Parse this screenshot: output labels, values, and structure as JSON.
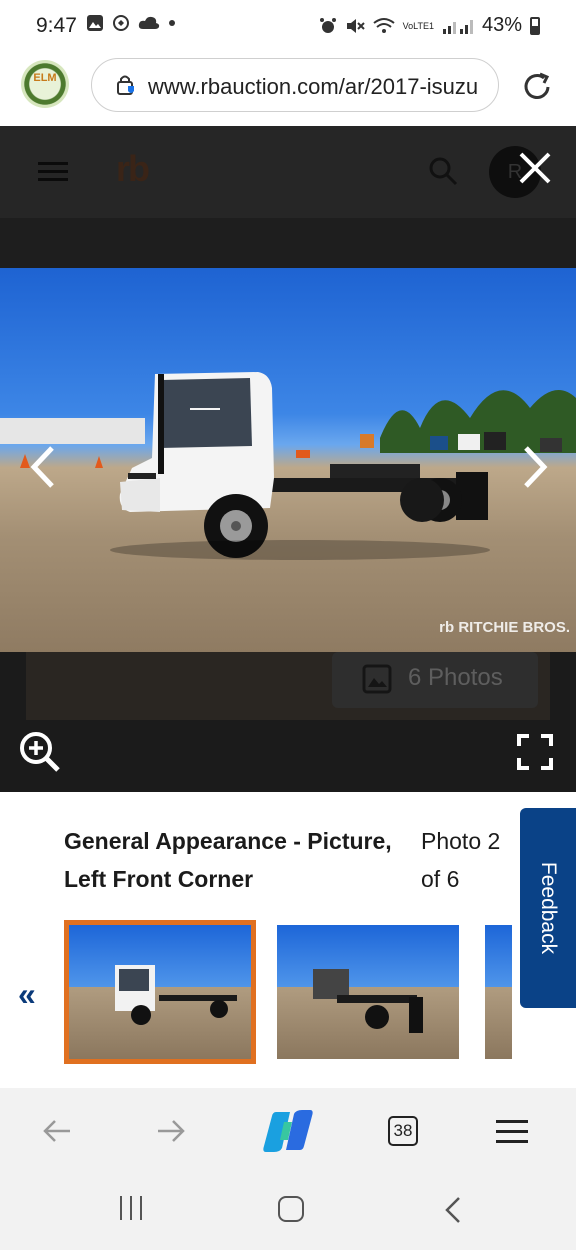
{
  "status_bar": {
    "time": "9:47",
    "battery": "43%",
    "network": "VoLTE1"
  },
  "browser": {
    "url": "www.rbauction.com/ar/2017-isuzu",
    "extension_logo_text": "ELM",
    "tab_count": "38"
  },
  "site_header": {
    "logo": "rb",
    "avatar_initials": "R"
  },
  "gallery": {
    "photos_label": "6 Photos",
    "watermark": "rb RITCHIE BROS.",
    "caption_title": "General Appearance - Picture, Left Front Corner",
    "caption_count": "Photo 2 of 6",
    "selected_thumb_color": "#e07020",
    "thumbs": [
      {
        "alt": "Left front corner view"
      },
      {
        "alt": "Rear left view"
      },
      {
        "alt": "Partial view"
      }
    ]
  },
  "feedback": {
    "label": "Feedback",
    "color": "#0a4287"
  },
  "icons": {
    "menu": "hamburger-menu-icon",
    "search": "search-icon",
    "close": "close-icon",
    "prev": "chevron-left-icon",
    "next": "chevron-right-icon",
    "zoom": "zoom-in-icon",
    "fullscreen": "fullscreen-icon",
    "image": "image-icon"
  }
}
